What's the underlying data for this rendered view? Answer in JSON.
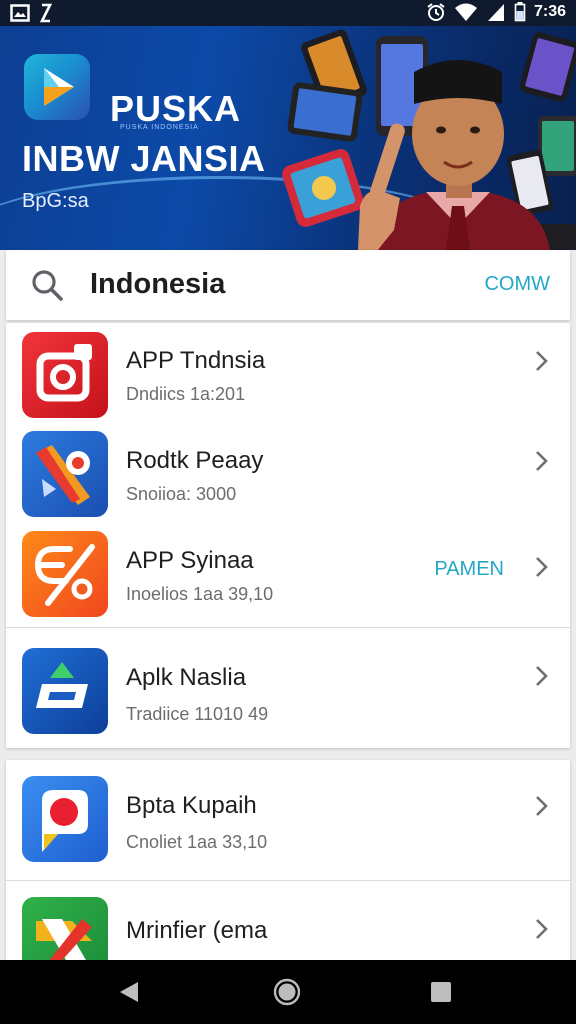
{
  "status_bar": {
    "time": "7:36",
    "icons_left": [
      "image-icon",
      "link-icon"
    ],
    "icons_right": [
      "alarm-icon",
      "wifi-icon",
      "signal-icon",
      "battery-icon"
    ]
  },
  "banner": {
    "brand": "PUSKA",
    "brand_sub": "PUSKA INDONESIA",
    "headline": "INBW JANSIA",
    "tagline": "BpG:sa"
  },
  "search": {
    "query": "Indonesia",
    "action": "COMW"
  },
  "apps": [
    {
      "title": "APP Tndnsia",
      "subtitle": "Dndiics 1a:201",
      "badge": "",
      "icon": "camera-app-icon"
    },
    {
      "title": "Rodtk Peaay",
      "subtitle": "Snoiioa: 3000",
      "badge": "",
      "icon": "pencil-app-icon"
    },
    {
      "title": "APP Syinaa",
      "subtitle": "Inoelios 1aa 39,10",
      "badge": "PAMEN",
      "icon": "percent-app-icon"
    },
    {
      "title": "Aplk Naslia",
      "subtitle": "Tradiice 11010 49",
      "badge": "",
      "icon": "e-app-icon"
    },
    {
      "title": "Bpta Kupaih",
      "subtitle": "Cnoliet 1aa 33,10",
      "badge": "",
      "icon": "pin-app-icon"
    },
    {
      "title": "Mrinfier (ema",
      "subtitle": "",
      "badge": "",
      "icon": "x-app-icon"
    }
  ],
  "colors": {
    "accent": "#23a8c6",
    "banner_blue": "#0c4aa8",
    "status_bar": "#0f1a2e",
    "nav_bar": "#000000"
  },
  "nav": [
    "back-icon",
    "home-icon",
    "recents-icon"
  ]
}
